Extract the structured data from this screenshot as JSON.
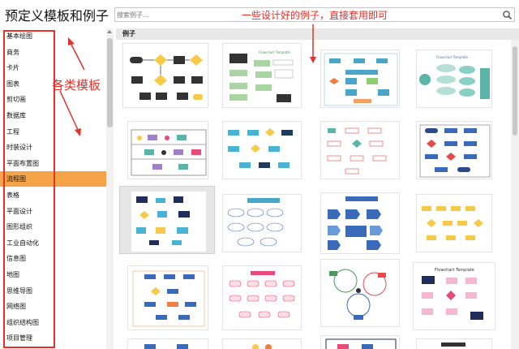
{
  "app": {
    "title": "预定义模板和例子"
  },
  "search": {
    "placeholder": "搜索例子..."
  },
  "sidebar": {
    "items": [
      {
        "label": "基本绘图"
      },
      {
        "label": "商务"
      },
      {
        "label": "卡片"
      },
      {
        "label": "图表"
      },
      {
        "label": "剪切画"
      },
      {
        "label": "数据库"
      },
      {
        "label": "工程"
      },
      {
        "label": "时装设计"
      },
      {
        "label": "平面布置图"
      },
      {
        "label": "流程图"
      },
      {
        "label": "表格"
      },
      {
        "label": "平面设计"
      },
      {
        "label": "图形组织"
      },
      {
        "label": "工业自动化"
      },
      {
        "label": "信息图"
      },
      {
        "label": "地图"
      },
      {
        "label": "思维导图"
      },
      {
        "label": "网络图"
      },
      {
        "label": "组织结构图"
      },
      {
        "label": "项目管理"
      }
    ],
    "active_index": 9,
    "active_color": "#f5a349"
  },
  "gallery": {
    "header": "例子",
    "thumbnail_titles": {
      "flowchart_template": "Flowchart Template",
      "flowchart_template_2": "Flowchart Template"
    }
  },
  "annotations": {
    "left": "各类模板",
    "top": "一些设计好的例子，直接套用即可",
    "color": "#e3312b"
  }
}
